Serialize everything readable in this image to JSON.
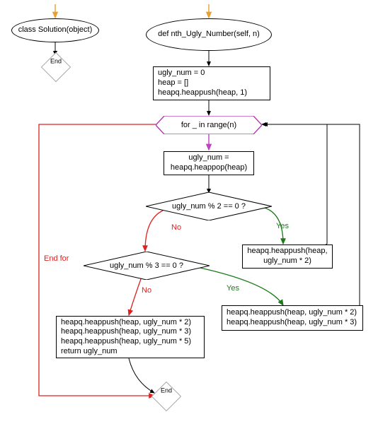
{
  "left_flow": {
    "class_def": "class Solution(object)",
    "end": "End"
  },
  "main_flow": {
    "func_def": "def nth_Ugly_Number(self, n)",
    "init_block": "ugly_num = 0\nheap = []\nheapq.heappush(heap, 1)",
    "loop_header": "for _ in range(n)",
    "pop_block": "ugly_num = heapq.heappop(heap)",
    "decision_mod2": "ugly_num % 2 == 0 ?",
    "decision_mod3": "ugly_num % 3 == 0 ?",
    "push2_block": "heapq.heappush(heap, ugly_num * 2)",
    "push23_block": "heapq.heappush(heap, ugly_num * 2)\nheapq.heappush(heap, ugly_num * 3)",
    "push235_block": "heapq.heappush(heap, ugly_num * 2)\nheapq.heappush(heap, ugly_num * 3)\nheapq.heappush(heap, ugly_num * 5)\nreturn ugly_num",
    "end": "End"
  },
  "labels": {
    "end_for": "End for",
    "yes": "Yes",
    "no": "No"
  },
  "chart_data": {
    "type": "flowchart",
    "title": "",
    "subgraphs": [
      {
        "nodes": [
          {
            "id": "start_left",
            "type": "start"
          },
          {
            "id": "class_def",
            "type": "terminator",
            "text": "class Solution(object)"
          },
          {
            "id": "end_left",
            "type": "end",
            "text": "End"
          }
        ],
        "edges": [
          {
            "from": "start_left",
            "to": "class_def"
          },
          {
            "from": "class_def",
            "to": "end_left"
          }
        ]
      },
      {
        "nodes": [
          {
            "id": "start_main",
            "type": "start"
          },
          {
            "id": "func_def",
            "type": "terminator",
            "text": "def nth_Ugly_Number(self, n)"
          },
          {
            "id": "init",
            "type": "process",
            "text": "ugly_num = 0; heap = []; heapq.heappush(heap, 1)"
          },
          {
            "id": "loop",
            "type": "loop",
            "text": "for _ in range(n)"
          },
          {
            "id": "pop",
            "type": "process",
            "text": "ugly_num = heapq.heappop(heap)"
          },
          {
            "id": "d2",
            "type": "decision",
            "text": "ugly_num % 2 == 0 ?"
          },
          {
            "id": "d3",
            "type": "decision",
            "text": "ugly_num % 3 == 0 ?"
          },
          {
            "id": "push2",
            "type": "process",
            "text": "heapq.heappush(heap, ugly_num * 2)"
          },
          {
            "id": "push23",
            "type": "process",
            "text": "heapq.heappush(heap, ugly_num * 2); heapq.heappush(heap, ugly_num * 3)"
          },
          {
            "id": "push235",
            "type": "process",
            "text": "heapq.heappush(heap, ugly_num * 2); heapq.heappush(heap, ugly_num * 3); heapq.heappush(heap, ugly_num * 5); return ugly_num"
          },
          {
            "id": "end_main",
            "type": "end",
            "text": "End"
          }
        ],
        "edges": [
          {
            "from": "start_main",
            "to": "func_def"
          },
          {
            "from": "func_def",
            "to": "init"
          },
          {
            "from": "init",
            "to": "loop"
          },
          {
            "from": "loop",
            "to": "pop",
            "label": ""
          },
          {
            "from": "loop",
            "to": "end_main",
            "label": "End for"
          },
          {
            "from": "pop",
            "to": "d2"
          },
          {
            "from": "d2",
            "to": "push2",
            "label": "Yes"
          },
          {
            "from": "d2",
            "to": "d3",
            "label": "No"
          },
          {
            "from": "push2",
            "to": "loop"
          },
          {
            "from": "d3",
            "to": "push23",
            "label": "Yes"
          },
          {
            "from": "d3",
            "to": "push235",
            "label": "No"
          },
          {
            "from": "push23",
            "to": "loop"
          },
          {
            "from": "push235",
            "to": "end_main"
          }
        ]
      }
    ]
  }
}
